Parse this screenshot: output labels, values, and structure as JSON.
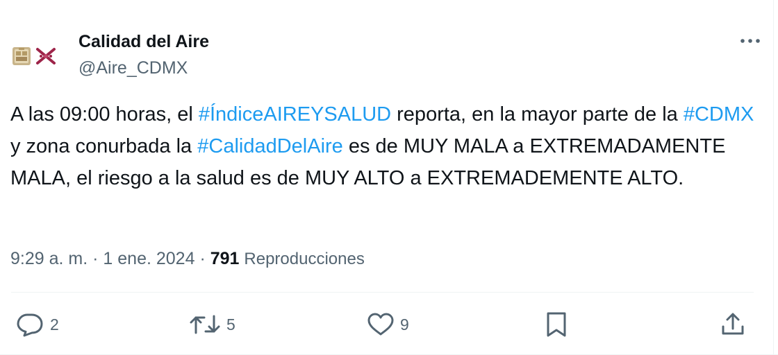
{
  "author": {
    "display_name": "Calidad del Aire",
    "handle": "@Aire_CDMX",
    "avatar_icons": [
      "coat-of-arms-icon",
      "cdmx-logo-icon"
    ]
  },
  "tweet": {
    "segments": [
      {
        "text": "A las 09:00 horas, el ",
        "type": "text"
      },
      {
        "text": "#ÍndiceAIREYSALUD",
        "type": "hashtag"
      },
      {
        "text": " reporta, en la mayor parte de la ",
        "type": "text"
      },
      {
        "text": "#CDMX",
        "type": "hashtag"
      },
      {
        "text": " y zona conurbada la ",
        "type": "text"
      },
      {
        "text": "#CalidadDelAire",
        "type": "hashtag"
      },
      {
        "text": " es de MUY MALA a EXTREMADAMENTE MALA, el riesgo a la salud es de MUY ALTO a EXTREMADEMENTE ALTO.",
        "type": "text"
      }
    ]
  },
  "meta": {
    "time": "9:29 a. m.",
    "separator": "·",
    "date": "1 ene. 2024",
    "views_count": "791",
    "views_label": "Reproducciones"
  },
  "actions": {
    "reply_count": "2",
    "retweet_count": "5",
    "like_count": "9"
  },
  "colors": {
    "hashtag": "#1d9bf0",
    "text": "#0f1419",
    "secondary": "#536471",
    "divider": "#eff3f4"
  }
}
